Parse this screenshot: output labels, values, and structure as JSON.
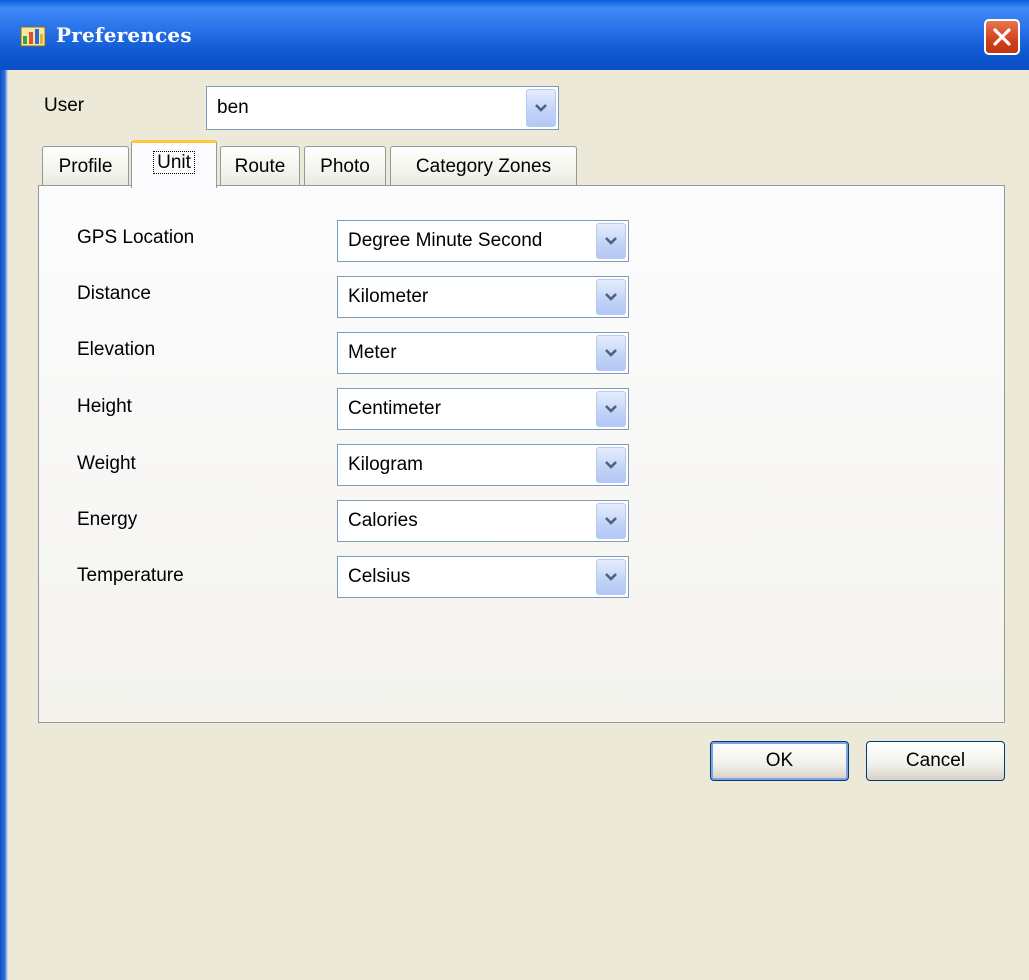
{
  "window": {
    "title": "Preferences",
    "title_icon": "app-icon",
    "close_icon": "close-icon"
  },
  "user": {
    "label": "User",
    "value": "ben"
  },
  "tabs": [
    {
      "label": "Profile",
      "active": false
    },
    {
      "label": "Unit",
      "active": true
    },
    {
      "label": "Route",
      "active": false
    },
    {
      "label": "Photo",
      "active": false
    },
    {
      "label": "Category Zones",
      "active": false
    }
  ],
  "units": [
    {
      "label": "GPS Location",
      "value": "Degree Minute Second"
    },
    {
      "label": "Distance",
      "value": "Kilometer"
    },
    {
      "label": "Elevation",
      "value": "Meter"
    },
    {
      "label": "Height",
      "value": "Centimeter"
    },
    {
      "label": "Weight",
      "value": "Kilogram"
    },
    {
      "label": "Energy",
      "value": "Calories"
    },
    {
      "label": "Temperature",
      "value": "Celsius"
    }
  ],
  "buttons": {
    "ok": "OK",
    "cancel": "Cancel"
  },
  "colors": {
    "titlebar": "#0e58d2",
    "close": "#d1401a",
    "active_tab_accent": "#ffc83c",
    "dialog_bg": "#ece9d8"
  }
}
